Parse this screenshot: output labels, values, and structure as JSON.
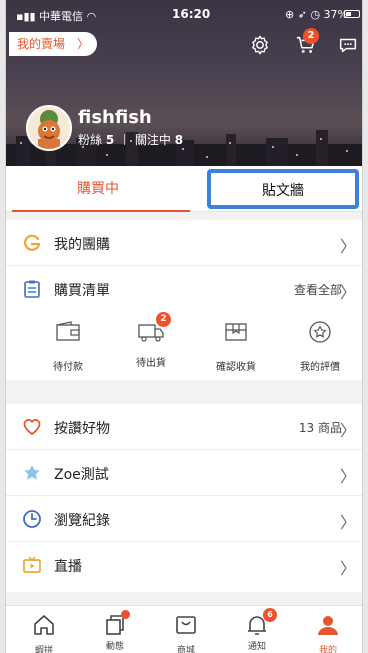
{
  "status_bar": {
    "carrier": "中華電信",
    "time": "16:20",
    "battery": "37%"
  },
  "header": {
    "shop_button": "我的賣場",
    "cart_badge": "2",
    "username": "fishfish",
    "followers_label": "粉絲",
    "followers_count": "5",
    "following_label": "關注中",
    "following_count": "8"
  },
  "tabs": [
    {
      "label": "購買中",
      "active": true
    },
    {
      "label": "貼文牆",
      "highlighted": true
    }
  ],
  "section1": {
    "group_buy": {
      "label": "我的團購",
      "icon": "g-icon"
    },
    "purchase_list": {
      "label": "購買清單",
      "extra": "查看全部"
    },
    "orders": [
      {
        "label": "待付款",
        "icon": "wallet-icon"
      },
      {
        "label": "待出貨",
        "icon": "truck-icon",
        "badge": "2"
      },
      {
        "label": "確認收貨",
        "icon": "box-icon"
      },
      {
        "label": "我的評價",
        "icon": "star-circle-icon"
      }
    ]
  },
  "section2": {
    "likes": {
      "label": "按讚好物",
      "extra": "13 商品"
    },
    "zoe": {
      "label": "Zoe測試"
    },
    "history": {
      "label": "瀏覽紀錄"
    },
    "live": {
      "label": "直播"
    }
  },
  "bottom_nav": [
    {
      "label": "蝦拼",
      "icon": "home-icon"
    },
    {
      "label": "動態",
      "icon": "feed-icon",
      "dot": true
    },
    {
      "label": "商城",
      "icon": "mall-icon"
    },
    {
      "label": "通知",
      "icon": "bell-icon",
      "badge": "6"
    },
    {
      "label": "我的",
      "icon": "person-icon",
      "active": true
    }
  ],
  "colors": {
    "accent": "#e4572e",
    "badge": "#f0512d",
    "highlight_border": "#3d7fe0"
  }
}
